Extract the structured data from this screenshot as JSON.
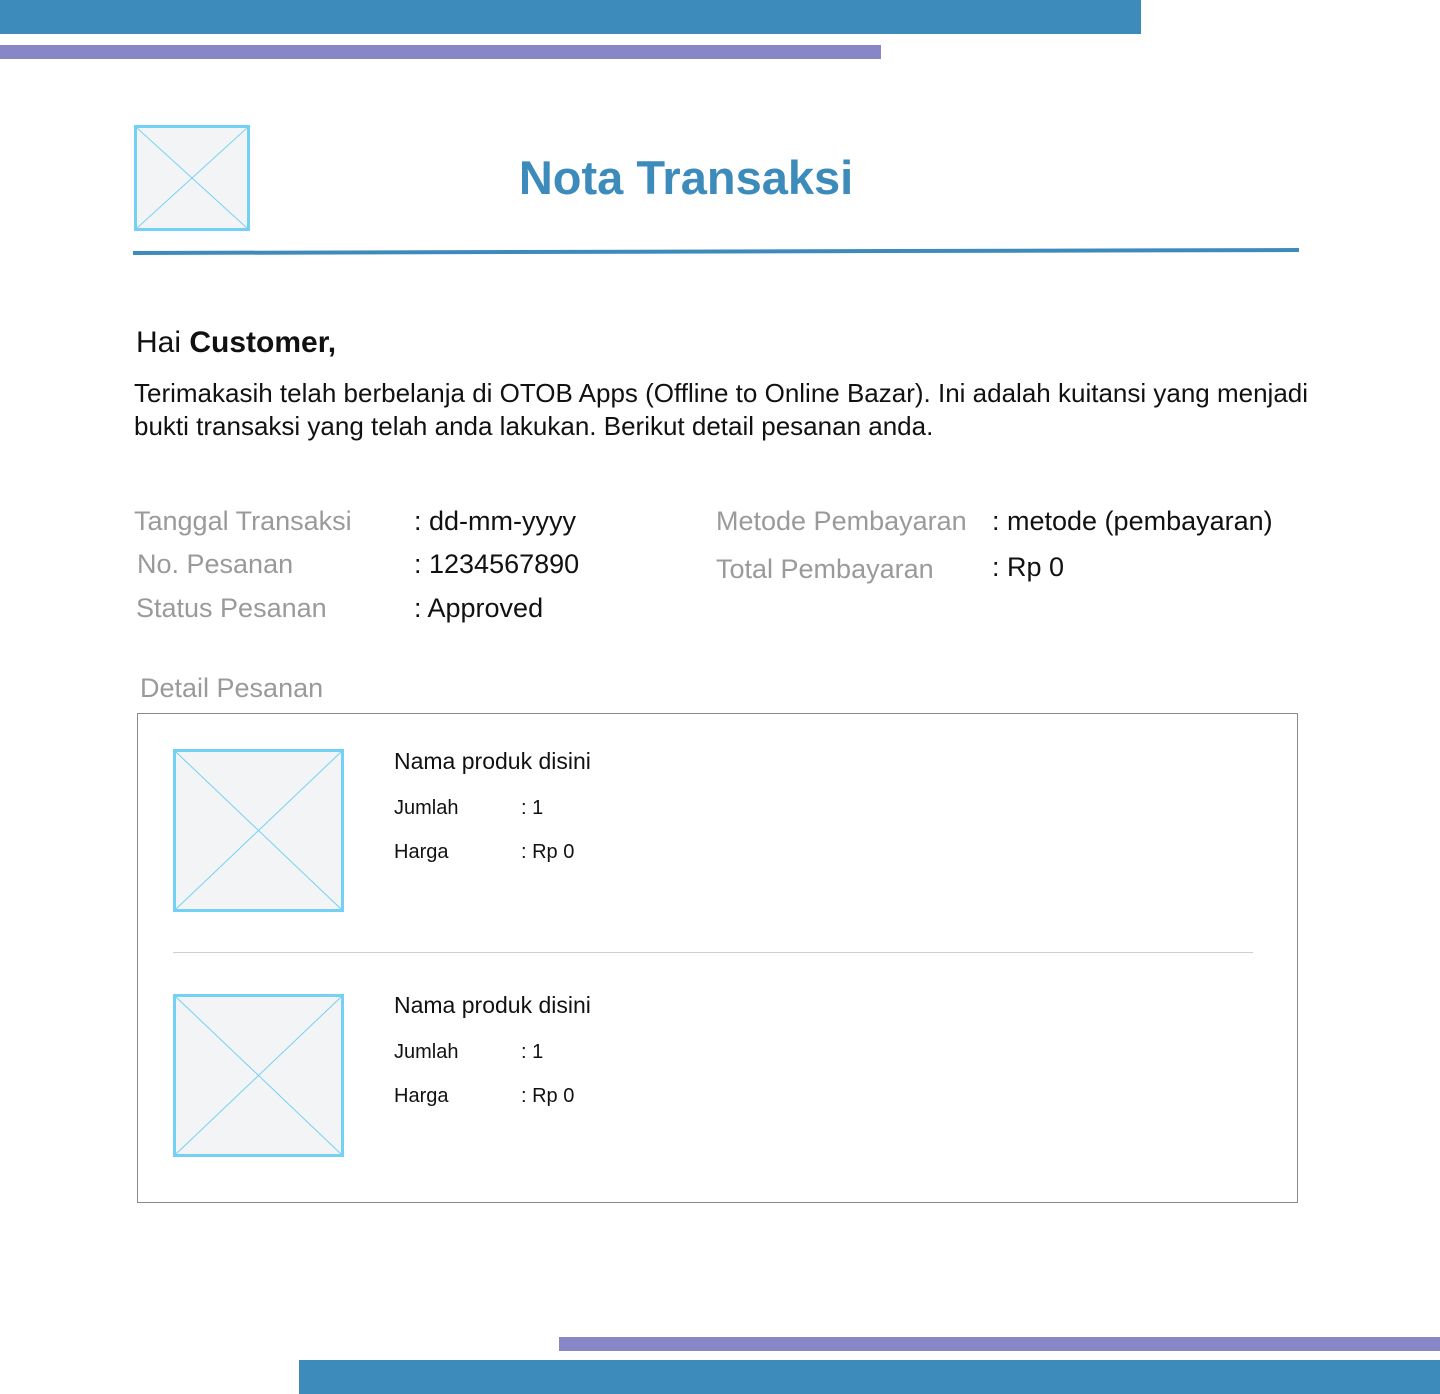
{
  "header": {
    "title": "Nota Transaksi",
    "logo_icon": "image-placeholder-icon"
  },
  "greeting": {
    "prefix": "Hai",
    "name": "Customer,"
  },
  "intro_text": "Terimakasih telah berbelanja di OTOB Apps (Offline to Online Bazar). Ini adalah kuitansi yang menjadi bukti transaksi yang telah anda lakukan. Berikut detail pesanan anda.",
  "transaction": {
    "date_label": "Tanggal Transaksi",
    "date_value": ": dd-mm-yyyy",
    "order_no_label": "No. Pesanan",
    "order_no_value": ": 1234567890",
    "status_label": "Status Pesanan",
    "status_value": ": Approved",
    "method_label": "Metode Pembayaran",
    "method_value": ": metode (pembayaran)",
    "total_label": "Total Pembayaran",
    "total_value": ": Rp 0"
  },
  "details": {
    "title": "Detail Pesanan",
    "items": [
      {
        "name": "Nama produk disini",
        "qty_label": "Jumlah",
        "qty_value": ": 1",
        "price_label": "Harga",
        "price_value": ": Rp 0"
      },
      {
        "name": "Nama produk disini",
        "qty_label": "Jumlah",
        "qty_value": ": 1",
        "price_label": "Harga",
        "price_value": ": Rp 0"
      }
    ]
  },
  "colors": {
    "primary_blue": "#3d8bbb",
    "accent_purple": "#8787c8",
    "placeholder_border": "#74d0f5",
    "label_gray": "#9a9a9a"
  }
}
